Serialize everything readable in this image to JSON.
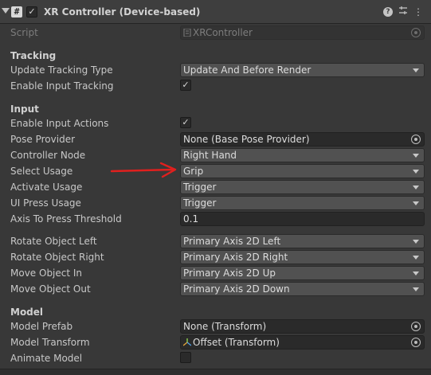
{
  "header": {
    "title": "XR Controller (Device-based)",
    "enabled": true,
    "component_icon": "#",
    "help_icon": "?",
    "presets_icon": "sliders-icon",
    "menu_icon": "⋮"
  },
  "script": {
    "label": "Script",
    "value": "XRController"
  },
  "tracking": {
    "heading": "Tracking",
    "update_type_label": "Update Tracking Type",
    "update_type_value": "Update And Before Render",
    "enable_input_tracking_label": "Enable Input Tracking",
    "enable_input_tracking": true
  },
  "input": {
    "heading": "Input",
    "enable_input_actions_label": "Enable Input Actions",
    "enable_input_actions": true,
    "pose_provider_label": "Pose Provider",
    "pose_provider_value": "None (Base Pose Provider)",
    "controller_node_label": "Controller Node",
    "controller_node_value": "Right Hand",
    "select_usage_label": "Select Usage",
    "select_usage_value": "Grip",
    "activate_usage_label": "Activate Usage",
    "activate_usage_value": "Trigger",
    "ui_press_usage_label": "UI Press Usage",
    "ui_press_usage_value": "Trigger",
    "axis_threshold_label": "Axis To Press Threshold",
    "axis_threshold_value": "0.1",
    "rotate_left_label": "Rotate Object Left",
    "rotate_left_value": "Primary Axis 2D Left",
    "rotate_right_label": "Rotate Object Right",
    "rotate_right_value": "Primary Axis 2D Right",
    "move_in_label": "Move Object In",
    "move_in_value": "Primary Axis 2D Up",
    "move_out_label": "Move Object Out",
    "move_out_value": "Primary Axis 2D Down"
  },
  "model": {
    "heading": "Model",
    "prefab_label": "Model Prefab",
    "prefab_value": "None (Transform)",
    "transform_label": "Model Transform",
    "transform_value": "Offset (Transform)",
    "animate_label": "Animate Model",
    "animate": false
  },
  "colors": {
    "background": "#383838",
    "annotation_arrow": "#e0201e"
  }
}
